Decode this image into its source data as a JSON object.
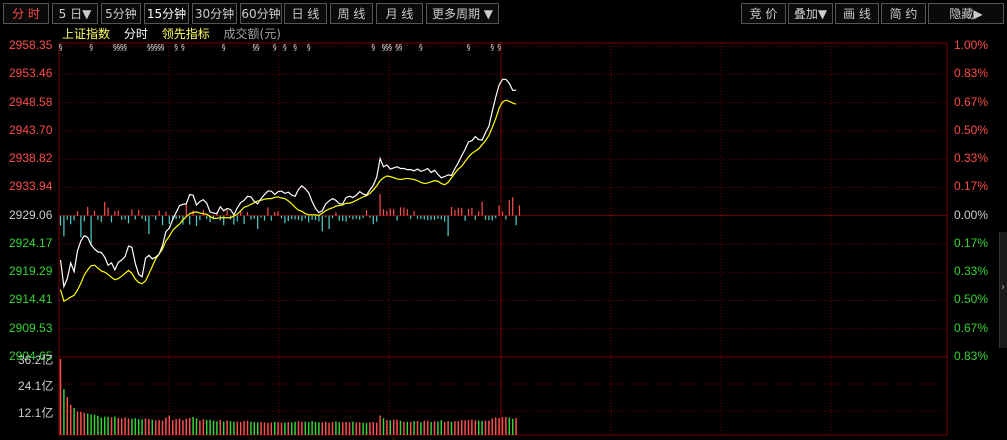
{
  "toolbar": {
    "period_tabs": [
      {
        "label": "分 时"
      },
      {
        "label": "5 日▼"
      },
      {
        "label": "5分钟"
      },
      {
        "label": "15分钟"
      },
      {
        "label": "30分钟"
      },
      {
        "label": "60分钟"
      },
      {
        "label": "日 线"
      },
      {
        "label": "周 线"
      },
      {
        "label": "月 线"
      },
      {
        "label": "更多周期 ▼"
      }
    ],
    "right_tabs": [
      {
        "label": "竞 价"
      },
      {
        "label": "叠加▼"
      },
      {
        "label": "画 线"
      },
      {
        "label": "简 约"
      },
      {
        "label": "隐藏▶"
      }
    ]
  },
  "legend": {
    "index_name": "上证指数",
    "series_minute": "分时",
    "series_leading": "领先指标",
    "series_amount": "成交额(元)"
  },
  "colors": {
    "up": "#ff4a4a",
    "down": "#35d335",
    "neutral": "#cccccc",
    "price_line": "#ffffff",
    "avg_line": "#ffff00",
    "volume_up": "#ff5050",
    "volume_down": "#4fd0d0",
    "grid": "#7a0000"
  },
  "chart_data": {
    "type": "line",
    "prev_close": 2929.06,
    "y_left_labels": [
      "2958.35",
      "2953.46",
      "2948.58",
      "2943.70",
      "2938.82",
      "2933.94",
      "2929.06",
      "2924.17",
      "2919.29",
      "2914.41",
      "2909.53",
      "2904.65"
    ],
    "y_right_labels": [
      "1.00%",
      "0.83%",
      "0.67%",
      "0.50%",
      "0.33%",
      "0.17%",
      "0.00%",
      "0.17%",
      "0.33%",
      "0.50%",
      "0.67%",
      "0.83%"
    ],
    "ylim": [
      2904.65,
      2958.35
    ],
    "volume_labels": [
      "36.2亿",
      "24.1亿",
      "12.1亿"
    ],
    "volume_max": 36.2,
    "price": [
      2921.4,
      2916.8,
      2918.2,
      2920.9,
      2919.4,
      2923.0,
      2924.7,
      2925.6,
      2925.3,
      2924.0,
      2923.3,
      2922.8,
      2922.7,
      2921.9,
      2920.5,
      2920.9,
      2919.7,
      2921.0,
      2921.4,
      2922.0,
      2923.8,
      2923.6,
      2920.8,
      2918.9,
      2918.5,
      2921.7,
      2922.2,
      2921.6,
      2921.9,
      2922.4,
      2923.9,
      2926.3,
      2926.9,
      2928.4,
      2929.6,
      2930.8,
      2931.0,
      2931.1,
      2932.7,
      2932.6,
      2930.9,
      2931.5,
      2931.8,
      2931.2,
      2929.7,
      2929.5,
      2929.4,
      2930.6,
      2929.9,
      2930.3,
      2930.1,
      2929.2,
      2930.4,
      2931.3,
      2931.7,
      2932.4,
      2932.3,
      2931.5,
      2931.1,
      2932.0,
      2932.7,
      2933.3,
      2933.3,
      2932.7,
      2933.2,
      2933.3,
      2932.9,
      2933.1,
      2932.6,
      2932.4,
      2933.6,
      2934.2,
      2933.7,
      2933.0,
      2931.5,
      2930.3,
      2929.6,
      2929.9,
      2931.1,
      2931.6,
      2932.0,
      2931.7,
      2931.1,
      2931.1,
      2932.2,
      2932.4,
      2932.2,
      2932.6,
      2933.2,
      2932.8,
      2932.6,
      2933.5,
      2934.3,
      2935.7,
      2938.9,
      2937.5,
      2937.8,
      2937.1,
      2937.3,
      2937.5,
      2937.2,
      2937.2,
      2937.0,
      2937.0,
      2936.8,
      2937.1,
      2936.7,
      2936.9,
      2937.2,
      2936.5,
      2936.9,
      2936.2,
      2935.6,
      2935.8,
      2936.1,
      2936.0,
      2937.2,
      2938.2,
      2939.4,
      2940.5,
      2941.8,
      2942.0,
      2942.7,
      2942.2,
      2942.1,
      2943.4,
      2944.5,
      2947.1,
      2949.5,
      2951.6,
      2952.6,
      2952.6,
      2951.9,
      2950.7,
      2950.7
    ],
    "avg": [
      2916.3,
      2914.3,
      2914.6,
      2915.0,
      2915.3,
      2916.2,
      2917.4,
      2918.8,
      2919.7,
      2920.4,
      2920.5,
      2920.0,
      2919.5,
      2919.3,
      2918.9,
      2918.4,
      2918.0,
      2918.2,
      2918.6,
      2919.1,
      2919.6,
      2919.1,
      2918.1,
      2917.5,
      2917.3,
      2917.8,
      2919.0,
      2920.3,
      2921.6,
      2922.4,
      2923.3,
      2924.7,
      2925.5,
      2926.5,
      2927.1,
      2927.6,
      2928.3,
      2928.9,
      2929.4,
      2929.6,
      2929.7,
      2929.5,
      2929.4,
      2929.3,
      2928.9,
      2928.6,
      2928.6,
      2928.7,
      2928.7,
      2928.7,
      2928.7,
      2929.0,
      2929.3,
      2929.9,
      2930.5,
      2930.7,
      2931.0,
      2931.3,
      2931.6,
      2931.7,
      2931.9,
      2932.0,
      2932.0,
      2932.2,
      2932.3,
      2932.1,
      2932.0,
      2931.6,
      2931.1,
      2930.5,
      2930.0,
      2929.8,
      2929.4,
      2929.2,
      2929.2,
      2929.2,
      2929.1,
      2929.5,
      2929.9,
      2930.2,
      2930.4,
      2930.7,
      2930.8,
      2930.9,
      2931.2,
      2931.2,
      2931.4,
      2931.7,
      2932.0,
      2932.3,
      2932.5,
      2932.9,
      2933.5,
      2934.2,
      2935.1,
      2935.6,
      2935.9,
      2935.8,
      2935.6,
      2935.4,
      2935.3,
      2935.4,
      2935.5,
      2935.4,
      2935.3,
      2935.1,
      2934.8,
      2934.6,
      2934.7,
      2934.9,
      2935.1,
      2935.0,
      2934.6,
      2934.4,
      2934.8,
      2935.6,
      2936.4,
      2937.1,
      2937.6,
      2938.4,
      2939.2,
      2939.8,
      2940.2,
      2940.6,
      2941.3,
      2942.0,
      2942.9,
      2944.3,
      2945.8,
      2947.6,
      2948.7,
      2949.0,
      2948.8,
      2948.5,
      2948.3
    ],
    "leading_bars": [
      -3.1,
      -6.5,
      -1.3,
      -2.7,
      -1.5,
      1.4,
      -6.8,
      -1.8,
      2.7,
      -9.3,
      1.5,
      -1.3,
      -2.0,
      4.3,
      2.5,
      -2.1,
      1.4,
      1.6,
      -1.3,
      -1.2,
      -2.4,
      1.9,
      -1.2,
      1.8,
      -1.0,
      -1.8,
      -5.8,
      -0.2,
      -1.3,
      1.6,
      -3.0,
      1.2,
      -2.6,
      -1.6,
      -1.1,
      -0.8,
      -2.8,
      3.8,
      -2.8,
      1.6,
      -3.2,
      -1.4,
      1.8,
      -1.0,
      -2.0,
      -1.2,
      1.1,
      -1.5,
      -3.0,
      1.7,
      -1.2,
      -2.8,
      -1.8,
      1.3,
      -2.6,
      1.1,
      -1.2,
      -1.0,
      -4.2,
      -0.6,
      -1.5,
      2.6,
      -1.6,
      1.1,
      1.3,
      -0.8,
      -2.4,
      -1.7,
      -1.1,
      -1.2,
      -1.3,
      -1.7,
      -0.9,
      -2.1,
      -1.3,
      -1.4,
      -1.8,
      -4.9,
      -0.5,
      -4.2,
      -0.8,
      1.0,
      -1.6,
      -1.7,
      -1.9,
      -0.7,
      -1.2,
      -1.0,
      -1.3,
      -0.8,
      1.7,
      -0.6,
      -2.7,
      -1.9,
      6.8,
      2.0,
      1.5,
      2.2,
      2.0,
      -1.5,
      2.6,
      2.5,
      2.0,
      -1.0,
      1.5,
      -1.0,
      -1.1,
      -1.2,
      -1.4,
      -1.3,
      -1.3,
      -1.0,
      -1.2,
      -1.9,
      -6.4,
      2.7,
      1.8,
      2.5,
      2.4,
      -1.6,
      2.1,
      2.5,
      -1.3,
      1.4,
      4.4,
      -1.3,
      -1.4,
      -1.5,
      -0.8,
      3.2,
      1.3,
      -1.2,
      4.9,
      5.8,
      -3.0,
      3.2
    ],
    "volume": [
      36.2,
      21.8,
      18.1,
      14.4,
      12.9,
      11.2,
      11.0,
      10.6,
      10.3,
      9.8,
      9.7,
      9.2,
      8.3,
      8.7,
      8.6,
      8.4,
      8.8,
      8.1,
      7.9,
      8.4,
      7.9,
      7.8,
      8.0,
      7.5,
      7.4,
      7.9,
      7.6,
      7.3,
      7.0,
      7.1,
      6.9,
      8.3,
      9.2,
      7.1,
      7.6,
      7.8,
      7.0,
      7.7,
      8.1,
      8.6,
      7.9,
      6.9,
      7.5,
      7.2,
      7.3,
      6.8,
      6.5,
      7.2,
      6.4,
      6.9,
      6.6,
      6.3,
      6.4,
      6.2,
      6.7,
      6.8,
      6.3,
      6.1,
      6.0,
      6.2,
      6.0,
      5.8,
      6.0,
      6.2,
      6.1,
      5.9,
      5.9,
      6.1,
      6.0,
      6.3,
      6.5,
      6.2,
      6.4,
      6.2,
      6.6,
      6.2,
      6.1,
      6.0,
      6.3,
      5.9,
      6.2,
      6.4,
      6.1,
      6.1,
      6.2,
      6.0,
      6.3,
      6.0,
      6.0,
      5.9,
      5.8,
      6.0,
      6.2,
      5.9,
      9.3,
      8.0,
      7.1,
      7.0,
      7.3,
      7.3,
      6.8,
      6.3,
      6.3,
      6.3,
      6.6,
      6.6,
      6.1,
      6.8,
      6.8,
      6.2,
      6.5,
      6.4,
      7.0,
      6.2,
      6.6,
      6.3,
      6.6,
      6.6,
      7.1,
      7.0,
      7.1,
      7.3,
      7.0,
      6.8,
      6.7,
      6.8,
      6.8,
      7.9,
      8.4,
      8.1,
      8.5,
      8.6,
      8.3,
      7.7,
      8.1
    ],
    "markers_top": [
      "§",
      "§",
      "§",
      "§",
      "§",
      "§",
      "§",
      "§",
      "§",
      "§",
      "§",
      "§",
      "§",
      "§",
      "§",
      "§",
      "§",
      "§",
      "§",
      "§",
      "§",
      "§",
      "§",
      "§",
      "§",
      "§",
      "§",
      "§",
      "§",
      "§"
    ]
  }
}
